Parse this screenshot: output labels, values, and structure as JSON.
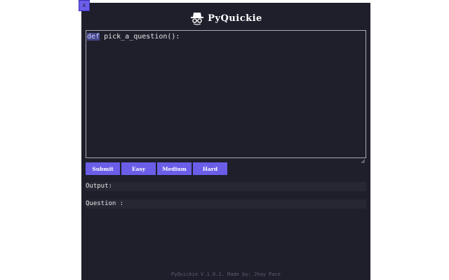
{
  "window": {
    "close_label": "x"
  },
  "header": {
    "brand": "PyQuickie",
    "logo_icon": "hat-spy-icon"
  },
  "editor": {
    "keyword": "def",
    "code_rest": " pick_a_question():"
  },
  "buttons": {
    "submit": "Submit",
    "easy": "Easy",
    "medium": "Medium",
    "hard": "Hard"
  },
  "output": {
    "output_label": "Output:",
    "question_label": "Question :"
  },
  "footer": {
    "text": "PyQuickie V.1.0.1. Made by: Jhay Pace"
  },
  "colors": {
    "panel_bg": "#1e1f2b",
    "accent": "#6a5ee8",
    "output_bg": "#262733",
    "footer_text": "#5e6070"
  }
}
